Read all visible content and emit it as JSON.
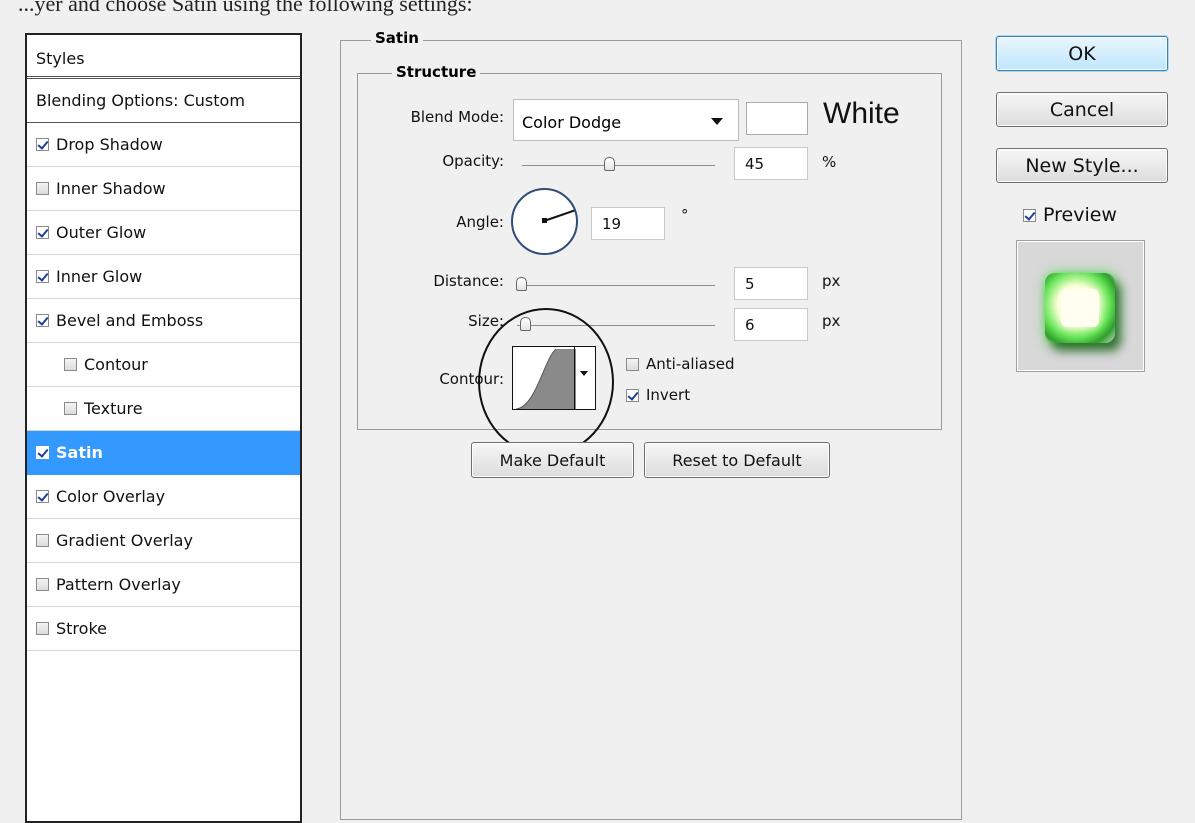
{
  "top_caption": "...yer and choose Satin using the following settings:",
  "sidebar": {
    "header": "Styles",
    "items": [
      {
        "label": "Blending Options: Custom",
        "checkbox": false,
        "checked": false,
        "indent": false,
        "selected": false
      },
      {
        "label": "Drop Shadow",
        "checkbox": true,
        "checked": true,
        "indent": false,
        "selected": false
      },
      {
        "label": "Inner Shadow",
        "checkbox": true,
        "checked": false,
        "indent": false,
        "selected": false
      },
      {
        "label": "Outer Glow",
        "checkbox": true,
        "checked": true,
        "indent": false,
        "selected": false
      },
      {
        "label": "Inner Glow",
        "checkbox": true,
        "checked": true,
        "indent": false,
        "selected": false
      },
      {
        "label": "Bevel and Emboss",
        "checkbox": true,
        "checked": true,
        "indent": false,
        "selected": false
      },
      {
        "label": "Contour",
        "checkbox": true,
        "checked": false,
        "indent": true,
        "selected": false
      },
      {
        "label": "Texture",
        "checkbox": true,
        "checked": false,
        "indent": true,
        "selected": false
      },
      {
        "label": "Satin",
        "checkbox": true,
        "checked": true,
        "indent": false,
        "selected": true
      },
      {
        "label": "Color Overlay",
        "checkbox": true,
        "checked": true,
        "indent": false,
        "selected": false
      },
      {
        "label": "Gradient Overlay",
        "checkbox": true,
        "checked": false,
        "indent": false,
        "selected": false
      },
      {
        "label": "Pattern Overlay",
        "checkbox": true,
        "checked": false,
        "indent": false,
        "selected": false
      },
      {
        "label": "Stroke",
        "checkbox": true,
        "checked": false,
        "indent": false,
        "selected": false
      }
    ]
  },
  "satin": {
    "group_title": "Satin",
    "structure_title": "Structure",
    "blend_mode_label": "Blend Mode:",
    "blend_mode_value": "Color Dodge",
    "color_name": "White",
    "color": "#ffffff",
    "opacity_label": "Opacity:",
    "opacity_value": "45",
    "opacity_unit": "%",
    "opacity_level": 0.45,
    "angle_label": "Angle:",
    "angle_value": "19",
    "angle_unit": "°",
    "distance_label": "Distance:",
    "distance_value": "5",
    "distance_unit": "px",
    "distance_level": 0.02,
    "size_label": "Size:",
    "size_value": "6",
    "size_unit": "px",
    "size_level": 0.04,
    "contour_label": "Contour:",
    "anti_aliased_label": "Anti-aliased",
    "anti_aliased_checked": false,
    "invert_label": "Invert",
    "invert_checked": true,
    "make_default_label": "Make Default",
    "reset_default_label": "Reset to Default"
  },
  "actions": {
    "ok_label": "OK",
    "cancel_label": "Cancel",
    "new_style_label": "New Style...",
    "preview_label": "Preview",
    "preview_checked": true
  },
  "colors": {
    "selection": "#3399ff",
    "preview_green": "#3ab83a"
  }
}
